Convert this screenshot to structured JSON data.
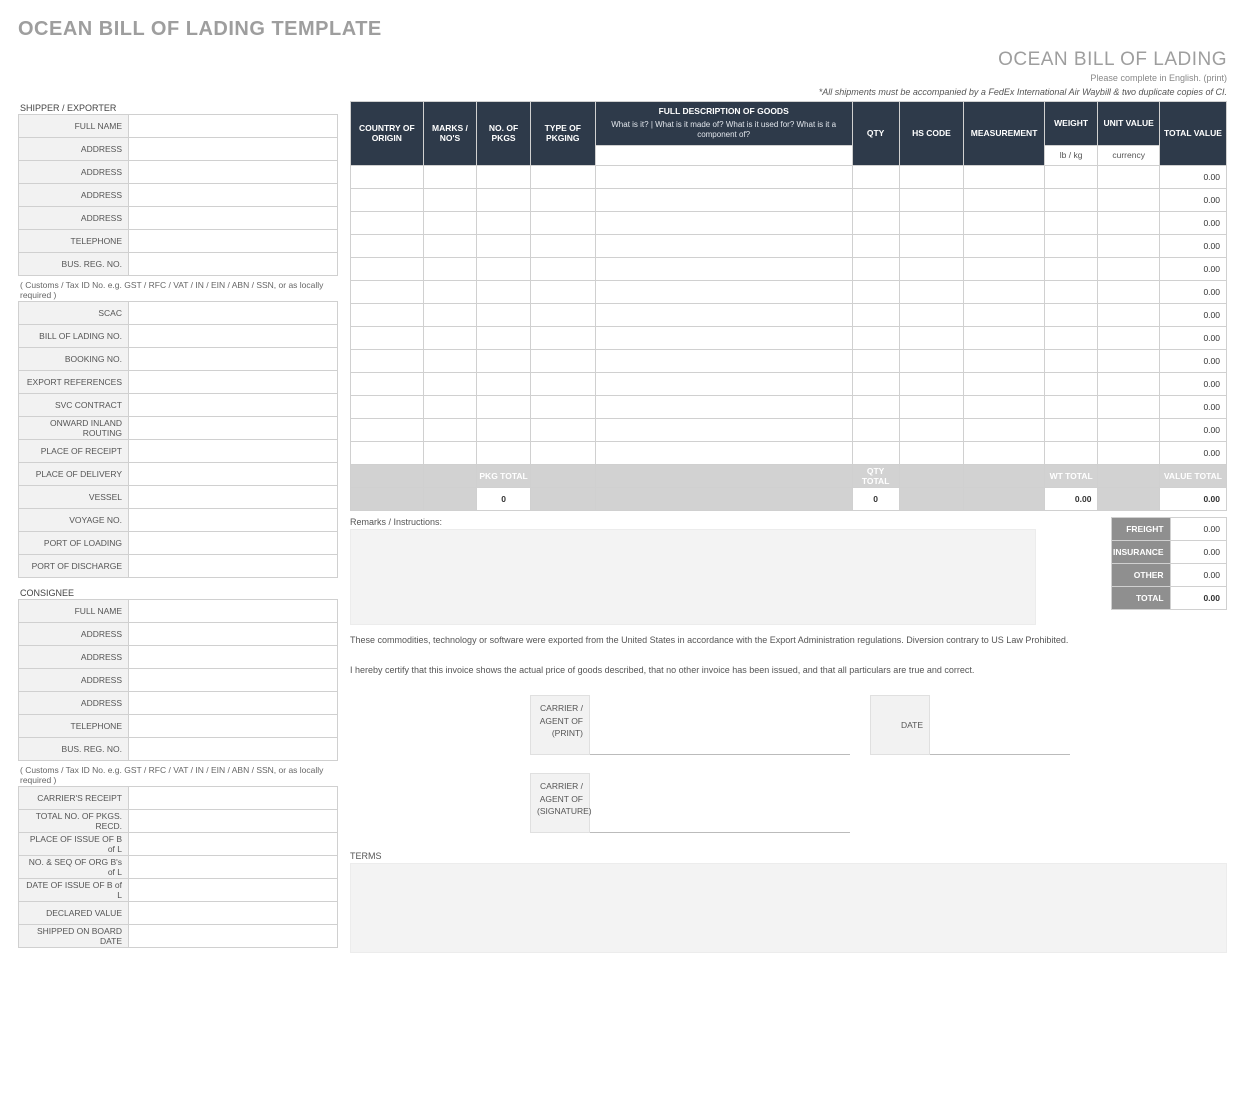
{
  "page_title": "OCEAN BILL OF LADING TEMPLATE",
  "header": {
    "title": "OCEAN BILL OF LADING",
    "subtitle": "Please complete in English. (print)",
    "note": "*All shipments must be accompanied by a FedEx International Air Waybill & two duplicate copies of CI."
  },
  "shipper": {
    "heading": "SHIPPER / EXPORTER",
    "tax_note": "( Customs / Tax ID No. e.g. GST / RFC / VAT / IN / EIN / ABN / SSN, or as locally required )",
    "rows1": [
      {
        "label": "FULL NAME",
        "value": ""
      },
      {
        "label": "ADDRESS",
        "value": ""
      },
      {
        "label": "ADDRESS",
        "value": ""
      },
      {
        "label": "ADDRESS",
        "value": ""
      },
      {
        "label": "ADDRESS",
        "value": ""
      },
      {
        "label": "TELEPHONE",
        "value": ""
      },
      {
        "label": "BUS. REG. NO.",
        "value": ""
      }
    ],
    "rows2": [
      {
        "label": "SCAC",
        "value": ""
      },
      {
        "label": "BILL OF LADING NO.",
        "value": ""
      },
      {
        "label": "BOOKING NO.",
        "value": ""
      },
      {
        "label": "EXPORT REFERENCES",
        "value": ""
      },
      {
        "label": "SVC CONTRACT",
        "value": ""
      },
      {
        "label": "ONWARD INLAND ROUTING",
        "value": ""
      },
      {
        "label": "PLACE OF RECEIPT",
        "value": ""
      },
      {
        "label": "PLACE OF DELIVERY",
        "value": ""
      },
      {
        "label": "VESSEL",
        "value": ""
      },
      {
        "label": "VOYAGE NO.",
        "value": ""
      },
      {
        "label": "PORT OF LOADING",
        "value": ""
      },
      {
        "label": "PORT OF DISCHARGE",
        "value": ""
      }
    ]
  },
  "consignee": {
    "heading": "CONSIGNEE",
    "tax_note": "( Customs / Tax ID No. e.g. GST / RFC / VAT / IN / EIN / ABN / SSN, or as locally required )",
    "rows1": [
      {
        "label": "FULL NAME",
        "value": ""
      },
      {
        "label": "ADDRESS",
        "value": ""
      },
      {
        "label": "ADDRESS",
        "value": ""
      },
      {
        "label": "ADDRESS",
        "value": ""
      },
      {
        "label": "ADDRESS",
        "value": ""
      },
      {
        "label": "TELEPHONE",
        "value": ""
      },
      {
        "label": "BUS. REG. NO.",
        "value": ""
      }
    ],
    "rows2": [
      {
        "label": "CARRIER'S RECEIPT",
        "value": ""
      },
      {
        "label": "TOTAL NO. OF PKGS. RECD.",
        "value": ""
      },
      {
        "label": "PLACE OF ISSUE OF B of L",
        "value": ""
      },
      {
        "label": "NO. & SEQ OF ORG B's of L",
        "value": ""
      },
      {
        "label": "DATE OF ISSUE OF B of L",
        "value": ""
      },
      {
        "label": "DECLARED VALUE",
        "value": ""
      },
      {
        "label": "SHIPPED ON BOARD DATE",
        "value": ""
      }
    ]
  },
  "goods": {
    "headers": {
      "country": "COUNTRY OF ORIGIN",
      "marks": "MARKS / NO'S",
      "pkgs": "NO. OF PKGS",
      "type": "TYPE OF PKGING",
      "desc": "FULL DESCRIPTION OF GOODS",
      "desc_sub": "What is it?  |  What is it made of?  What is it used for?  What is it a component of?",
      "qty": "QTY",
      "hs": "HS CODE",
      "meas": "MEASUREMENT",
      "weight": "WEIGHT",
      "weight_sub": "lb / kg",
      "unit": "UNIT VALUE",
      "unit_sub": "currency",
      "total": "TOTAL VALUE"
    },
    "rows": [
      {
        "total": "0.00"
      },
      {
        "total": "0.00"
      },
      {
        "total": "0.00"
      },
      {
        "total": "0.00"
      },
      {
        "total": "0.00"
      },
      {
        "total": "0.00"
      },
      {
        "total": "0.00"
      },
      {
        "total": "0.00"
      },
      {
        "total": "0.00"
      },
      {
        "total": "0.00"
      },
      {
        "total": "0.00"
      },
      {
        "total": "0.00"
      },
      {
        "total": "0.00"
      }
    ],
    "totals": {
      "pkg_label": "PKG TOTAL",
      "pkg_value": "0",
      "qty_label": "QTY TOTAL",
      "qty_value": "0",
      "wt_label": "WT TOTAL",
      "wt_value": "0.00",
      "value_label": "VALUE TOTAL",
      "value_value": "0.00"
    }
  },
  "charges": {
    "rows": [
      {
        "label": "FREIGHT",
        "value": "0.00"
      },
      {
        "label": "INSURANCE",
        "value": "0.00"
      },
      {
        "label": "OTHER",
        "value": "0.00"
      }
    ],
    "grand": {
      "label": "TOTAL",
      "value": "0.00"
    }
  },
  "remarks": {
    "label": "Remarks / Instructions:",
    "value": ""
  },
  "legal": {
    "export": "These commodities, technology or software were exported from the United States in accordance with the Export Administration regulations.  Diversion contrary to US Law Prohibited.",
    "certify": "I hereby certify that this invoice shows the actual price of goods described, that no other invoice has been issued, and that all particulars are true and correct."
  },
  "sign": {
    "print_label": "CARRIER / AGENT OF (PRINT)",
    "sig_label": "CARRIER / AGENT OF (SIGNATURE)",
    "date_label": "DATE"
  },
  "terms": {
    "label": "TERMS",
    "value": ""
  }
}
